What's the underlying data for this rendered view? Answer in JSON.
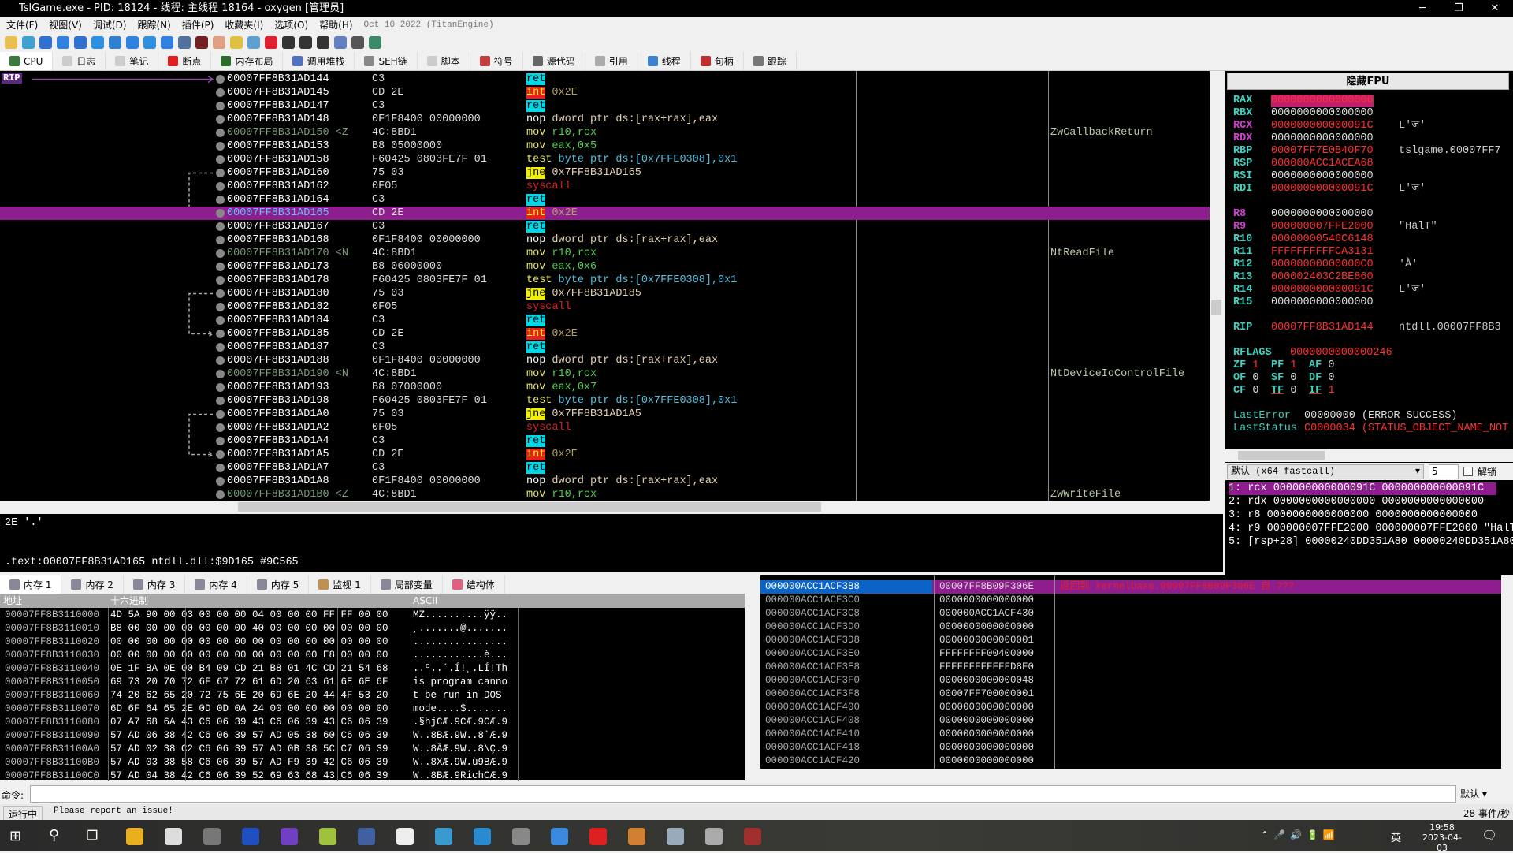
{
  "window": {
    "title": "TslGame.exe - PID: 18124 - 线程: 主线程 18164 - oxygen [管理员]",
    "minimize": "─",
    "maximize": "❐",
    "close": "✕"
  },
  "menu": [
    "文件(F)",
    "视图(V)",
    "调试(D)",
    "跟踪(N)",
    "插件(P)",
    "收藏夹(I)",
    "选项(O)",
    "帮助(H)"
  ],
  "version": "Oct 10 2022 (TitanEngine)",
  "toolbar_icons": [
    "open-icon",
    "restart-icon",
    "stop-icon",
    "run-icon",
    "pause-icon",
    "step-into-icon",
    "step-over-icon",
    "trace-into-icon",
    "trace-over-icon",
    "execute-till-return-icon",
    "run-to-user-code-icon",
    "scylla-icon",
    "patch-icon",
    "comment-icon",
    "label-icon",
    "bookmark-icon",
    "function-icon",
    "hash-icon",
    "font-icon",
    "calculator-icon",
    "notes-icon",
    "globe-icon"
  ],
  "tabs": [
    {
      "label": "CPU",
      "icon": "cpu-icon",
      "color": "#3a7a3a"
    },
    {
      "label": "日志",
      "icon": "log-icon",
      "color": "#ccc"
    },
    {
      "label": "笔记",
      "icon": "notes-icon",
      "color": "#ccc"
    },
    {
      "label": "断点",
      "icon": "breakpoint-icon",
      "color": "#e02020"
    },
    {
      "label": "内存布局",
      "icon": "memory-map-icon",
      "color": "#2a6a2a"
    },
    {
      "label": "调用堆栈",
      "icon": "call-stack-icon",
      "color": "#5070c0"
    },
    {
      "label": "SEH链",
      "icon": "seh-icon",
      "color": "#888"
    },
    {
      "label": "脚本",
      "icon": "script-icon",
      "color": "#ccc"
    },
    {
      "label": "符号",
      "icon": "symbols-icon",
      "color": "#c04040"
    },
    {
      "label": "源代码",
      "icon": "source-icon",
      "color": "#666"
    },
    {
      "label": "引用",
      "icon": "references-icon",
      "color": "#aaa"
    },
    {
      "label": "线程",
      "icon": "threads-icon",
      "color": "#4080d0"
    },
    {
      "label": "句柄",
      "icon": "handles-icon",
      "color": "#c03030"
    },
    {
      "label": "跟踪",
      "icon": "trace-icon",
      "color": "#777"
    }
  ],
  "rip_label": "RIP",
  "disasm": [
    {
      "addr": "00007FF8B31AD144",
      "lbl": "",
      "bytes": "C3",
      "m": "ret",
      "t": "ret",
      "ops": "",
      "cmt": ""
    },
    {
      "addr": "00007FF8B31AD145",
      "lbl": "",
      "bytes": "CD 2E",
      "m": "int",
      "t": "int",
      "ops": "0x2E",
      "cmt": ""
    },
    {
      "addr": "00007FF8B31AD147",
      "lbl": "",
      "bytes": "C3",
      "m": "ret",
      "t": "ret",
      "ops": "",
      "cmt": ""
    },
    {
      "addr": "00007FF8B31AD148",
      "lbl": "",
      "bytes": "0F1F8400 00000000",
      "m": "nop",
      "t": "nop",
      "ops": "dword ptr ds:[rax+rax],eax",
      "cmt": ""
    },
    {
      "addr": "00007FF8B31AD150",
      "lbl": " <Z",
      "bytes": "4C:8BD1",
      "m": "mov",
      "t": "mov",
      "ops": "r10,rcx",
      "cmt": "ZwCallbackReturn"
    },
    {
      "addr": "00007FF8B31AD153",
      "lbl": "",
      "bytes": "B8 05000000",
      "m": "mov",
      "t": "mov",
      "ops": "eax,0x5",
      "cmt": ""
    },
    {
      "addr": "00007FF8B31AD158",
      "lbl": "",
      "bytes": "F60425 0803FE7F 01",
      "m": "test",
      "t": "test",
      "ops": "byte ptr ds:[0x7FFE0308],0x1",
      "cmt": ""
    },
    {
      "addr": "00007FF8B31AD160",
      "lbl": "",
      "bytes": "75 03",
      "m": "jne",
      "t": "jne",
      "ops": "0x7FF8B31AD165",
      "cmt": ""
    },
    {
      "addr": "00007FF8B31AD162",
      "lbl": "",
      "bytes": "0F05",
      "m": "syscall",
      "t": "sys",
      "ops": "",
      "cmt": ""
    },
    {
      "addr": "00007FF8B31AD164",
      "lbl": "",
      "bytes": "C3",
      "m": "ret",
      "t": "ret",
      "ops": "",
      "cmt": ""
    },
    {
      "addr": "00007FF8B31AD165",
      "lbl": "",
      "bytes": "CD 2E",
      "m": "int",
      "t": "int",
      "ops": "0x2E",
      "cmt": "",
      "selected": true
    },
    {
      "addr": "00007FF8B31AD167",
      "lbl": "",
      "bytes": "C3",
      "m": "ret",
      "t": "ret",
      "ops": "",
      "cmt": ""
    },
    {
      "addr": "00007FF8B31AD168",
      "lbl": "",
      "bytes": "0F1F8400 00000000",
      "m": "nop",
      "t": "nop",
      "ops": "dword ptr ds:[rax+rax],eax",
      "cmt": ""
    },
    {
      "addr": "00007FF8B31AD170",
      "lbl": " <N",
      "bytes": "4C:8BD1",
      "m": "mov",
      "t": "mov",
      "ops": "r10,rcx",
      "cmt": "NtReadFile"
    },
    {
      "addr": "00007FF8B31AD173",
      "lbl": "",
      "bytes": "B8 06000000",
      "m": "mov",
      "t": "mov",
      "ops": "eax,0x6",
      "cmt": ""
    },
    {
      "addr": "00007FF8B31AD178",
      "lbl": "",
      "bytes": "F60425 0803FE7F 01",
      "m": "test",
      "t": "test",
      "ops": "byte ptr ds:[0x7FFE0308],0x1",
      "cmt": ""
    },
    {
      "addr": "00007FF8B31AD180",
      "lbl": "",
      "bytes": "75 03",
      "m": "jne",
      "t": "jne",
      "ops": "0x7FF8B31AD185",
      "cmt": ""
    },
    {
      "addr": "00007FF8B31AD182",
      "lbl": "",
      "bytes": "0F05",
      "m": "syscall",
      "t": "sys",
      "ops": "",
      "cmt": ""
    },
    {
      "addr": "00007FF8B31AD184",
      "lbl": "",
      "bytes": "C3",
      "m": "ret",
      "t": "ret",
      "ops": "",
      "cmt": ""
    },
    {
      "addr": "00007FF8B31AD185",
      "lbl": "",
      "bytes": "CD 2E",
      "m": "int",
      "t": "int",
      "ops": "0x2E",
      "cmt": ""
    },
    {
      "addr": "00007FF8B31AD187",
      "lbl": "",
      "bytes": "C3",
      "m": "ret",
      "t": "ret",
      "ops": "",
      "cmt": ""
    },
    {
      "addr": "00007FF8B31AD188",
      "lbl": "",
      "bytes": "0F1F8400 00000000",
      "m": "nop",
      "t": "nop",
      "ops": "dword ptr ds:[rax+rax],eax",
      "cmt": ""
    },
    {
      "addr": "00007FF8B31AD190",
      "lbl": " <N",
      "bytes": "4C:8BD1",
      "m": "mov",
      "t": "mov",
      "ops": "r10,rcx",
      "cmt": "NtDeviceIoControlFile"
    },
    {
      "addr": "00007FF8B31AD193",
      "lbl": "",
      "bytes": "B8 07000000",
      "m": "mov",
      "t": "mov",
      "ops": "eax,0x7",
      "cmt": ""
    },
    {
      "addr": "00007FF8B31AD198",
      "lbl": "",
      "bytes": "F60425 0803FE7F 01",
      "m": "test",
      "t": "test",
      "ops": "byte ptr ds:[0x7FFE0308],0x1",
      "cmt": ""
    },
    {
      "addr": "00007FF8B31AD1A0",
      "lbl": "",
      "bytes": "75 03",
      "m": "jne",
      "t": "jne",
      "ops": "0x7FF8B31AD1A5",
      "cmt": ""
    },
    {
      "addr": "00007FF8B31AD1A2",
      "lbl": "",
      "bytes": "0F05",
      "m": "syscall",
      "t": "sys",
      "ops": "",
      "cmt": ""
    },
    {
      "addr": "00007FF8B31AD1A4",
      "lbl": "",
      "bytes": "C3",
      "m": "ret",
      "t": "ret",
      "ops": "",
      "cmt": ""
    },
    {
      "addr": "00007FF8B31AD1A5",
      "lbl": "",
      "bytes": "CD 2E",
      "m": "int",
      "t": "int",
      "ops": "0x2E",
      "cmt": ""
    },
    {
      "addr": "00007FF8B31AD1A7",
      "lbl": "",
      "bytes": "C3",
      "m": "ret",
      "t": "ret",
      "ops": "",
      "cmt": ""
    },
    {
      "addr": "00007FF8B31AD1A8",
      "lbl": "",
      "bytes": "0F1F8400 00000000",
      "m": "nop",
      "t": "nop",
      "ops": "dword ptr ds:[rax+rax],eax",
      "cmt": ""
    },
    {
      "addr": "00007FF8B31AD1B0",
      "lbl": " <Z",
      "bytes": "4C:8BD1",
      "m": "mov",
      "t": "mov",
      "ops": "r10,rcx",
      "cmt": "ZwWriteFile"
    }
  ],
  "info": {
    "line1": "2E '.'",
    "line2": ".text:00007FF8B31AD165 ntdll.dll:$9D165 #9C565"
  },
  "fpu_button": "隐藏FPU",
  "registers": [
    {
      "n": "RAX",
      "v": "0000000000000006",
      "c": "",
      "chg": true,
      "hl": true
    },
    {
      "n": "RBX",
      "v": "0000000000000000",
      "c": ""
    },
    {
      "n": "RCX",
      "v": "000000000000091C",
      "c": "L'ज'",
      "chg": true,
      "mag": true
    },
    {
      "n": "RDX",
      "v": "0000000000000000",
      "c": "",
      "mag": true
    },
    {
      "n": "RBP",
      "v": "00007FF7E0B40F70",
      "c": "tslgame.00007FF7",
      "chg": true
    },
    {
      "n": "RSP",
      "v": "000000ACC1ACEA68",
      "c": "",
      "chg": true
    },
    {
      "n": "RSI",
      "v": "0000000000000000",
      "c": ""
    },
    {
      "n": "RDI",
      "v": "000000000000091C",
      "c": "L'ज'",
      "chg": true
    },
    {
      "gap": true
    },
    {
      "n": "R8",
      "v": "0000000000000000",
      "c": "",
      "mag": true
    },
    {
      "n": "R9",
      "v": "000000007FFE2000",
      "c": "\"HalT\"",
      "chg": true,
      "mag": true
    },
    {
      "n": "R10",
      "v": "00000000546C6148",
      "c": "",
      "chg": true
    },
    {
      "n": "R11",
      "v": "FFFFFFFFFFCA3131",
      "c": "",
      "chg": true
    },
    {
      "n": "R12",
      "v": "00000000000000C0",
      "c": "'À'",
      "chg": true
    },
    {
      "n": "R13",
      "v": "000002403C2BE860",
      "c": "",
      "chg": true
    },
    {
      "n": "R14",
      "v": "000000000000091C",
      "c": "L'ज'",
      "chg": true
    },
    {
      "n": "R15",
      "v": "0000000000000000",
      "c": ""
    },
    {
      "gap": true
    },
    {
      "n": "RIP",
      "v": "00007FF8B31AD144",
      "c": "ntdll.00007FF8B3",
      "chg": true
    }
  ],
  "rflags": {
    "label": "RFLAGS",
    "value": "0000000000000246",
    "flags": [
      [
        "ZF",
        "1"
      ],
      [
        "PF",
        "1"
      ],
      [
        "AF",
        "0"
      ],
      [
        "OF",
        "0"
      ],
      [
        "SF",
        "0"
      ],
      [
        "DF",
        "0"
      ],
      [
        "CF",
        "0"
      ],
      [
        "TF",
        "0"
      ],
      [
        "IF",
        "1"
      ]
    ]
  },
  "last_error": {
    "label": "LastError",
    "value": "00000000 (ERROR_SUCCESS)"
  },
  "last_status": {
    "label": "LastStatus",
    "value": "C0000034 (STATUS_OBJECT_NAME_NOT_FOUND)"
  },
  "callconv": {
    "selected": "默认 (x64 fastcall)",
    "count": "5",
    "unlock_label": "解锁",
    "unlocked": false
  },
  "args": [
    "1: rcx 000000000000091C 000000000000091C",
    "2: rdx 0000000000000000 0000000000000000",
    "3: r8 0000000000000000 0000000000000000",
    "4: r9 000000007FFE2000 000000007FFE2000 \"HalT\"",
    "5: [rsp+28] 00000240DD351A80 00000240DD351A80"
  ],
  "memtabs": [
    {
      "label": "内存 1",
      "icon": "memory-icon"
    },
    {
      "label": "内存 2",
      "icon": "memory-icon"
    },
    {
      "label": "内存 3",
      "icon": "memory-icon"
    },
    {
      "label": "内存 4",
      "icon": "memory-icon"
    },
    {
      "label": "内存 5",
      "icon": "memory-icon"
    },
    {
      "label": "监视 1",
      "icon": "watch-icon"
    },
    {
      "label": "局部变量",
      "icon": "locals-icon"
    },
    {
      "label": "结构体",
      "icon": "struct-icon"
    }
  ],
  "dump": {
    "headers": [
      "地址",
      "十六进制",
      "ASCII"
    ],
    "rows": [
      [
        "00007FF8B3110000",
        "4D 5A 90 00 03 00 00 00 04 00 00 00 FF FF 00 00",
        "MZ..........ÿÿ.."
      ],
      [
        "00007FF8B3110010",
        "B8 00 00 00 00 00 00 00 40 00 00 00 00 00 00 00",
        "¸.......@......."
      ],
      [
        "00007FF8B3110020",
        "00 00 00 00 00 00 00 00 00 00 00 00 00 00 00 00",
        "................"
      ],
      [
        "00007FF8B3110030",
        "00 00 00 00 00 00 00 00 00 00 00 00 E8 00 00 00",
        "............è..."
      ],
      [
        "00007FF8B3110040",
        "0E 1F BA 0E 00 B4 09 CD 21 B8 01 4C CD 21 54 68",
        "..º..´.Í!¸.LÍ!Th"
      ],
      [
        "00007FF8B3110050",
        "69 73 20 70 72 6F 67 72 61 6D 20 63 61 6E 6E 6F",
        "is program canno"
      ],
      [
        "00007FF8B3110060",
        "74 20 62 65 20 72 75 6E 20 69 6E 20 44 4F 53 20",
        "t be run in DOS "
      ],
      [
        "00007FF8B3110070",
        "6D 6F 64 65 2E 0D 0D 0A 24 00 00 00 00 00 00 00",
        "mode....$......."
      ],
      [
        "00007FF8B3110080",
        "07 A7 68 6A 43 C6 06 39 43 C6 06 39 43 C6 06 39",
        ".§hjCÆ.9CÆ.9CÆ.9"
      ],
      [
        "00007FF8B3110090",
        "57 AD 06 38 42 C6 06 39 57 AD 05 38 60 C6 06 39",
        "W..8BÆ.9W..8`Æ.9"
      ],
      [
        "00007FF8B31100A0",
        "57 AD 02 38 C2 C6 06 39 57 AD 0B 38 5C C7 06 39",
        "W..8ÂÆ.9W..8\\Ç.9"
      ],
      [
        "00007FF8B31100B0",
        "57 AD 03 38 58 C6 06 39 57 AD F9 39 42 C6 06 39",
        "W..8XÆ.9W.ù9BÆ.9"
      ],
      [
        "00007FF8B31100C0",
        "57 AD 04 38 42 C6 06 39 52 69 63 68 43 C6 06 39",
        "W..8BÆ.9RichCÆ.9"
      ]
    ]
  },
  "stack": [
    [
      "000000ACC1ACF3B8",
      "00007FF8B09F306E",
      "返回到 kernelbase.00007FF8B09F306E 自 ???"
    ],
    [
      "000000ACC1ACF3C0",
      "0000000000000000",
      ""
    ],
    [
      "000000ACC1ACF3C8",
      "000000ACC1ACF430",
      ""
    ],
    [
      "000000ACC1ACF3D0",
      "0000000000000000",
      ""
    ],
    [
      "000000ACC1ACF3D8",
      "0000000000000001",
      ""
    ],
    [
      "000000ACC1ACF3E0",
      "FFFFFFFF00400000",
      ""
    ],
    [
      "000000ACC1ACF3E8",
      "FFFFFFFFFFFFD8F0",
      ""
    ],
    [
      "000000ACC1ACF3F0",
      "0000000000000048",
      ""
    ],
    [
      "000000ACC1ACF3F8",
      "00007FF700000001",
      ""
    ],
    [
      "000000ACC1ACF400",
      "0000000000000000",
      ""
    ],
    [
      "000000ACC1ACF408",
      "0000000000000000",
      ""
    ],
    [
      "000000ACC1ACF410",
      "0000000000000000",
      ""
    ],
    [
      "000000ACC1ACF418",
      "0000000000000000",
      ""
    ],
    [
      "000000ACC1ACF420",
      "0000000000000000",
      ""
    ]
  ],
  "command": {
    "label": "命令:",
    "value": "",
    "mode": "默认"
  },
  "status": {
    "state": "运行中",
    "message": "Please report an issue!",
    "events": "28 事件/秒"
  },
  "taskbar": {
    "apps": [
      {
        "name": "chrome-icon",
        "color": "#e8b020"
      },
      {
        "name": "qq-icon",
        "color": "#ddd"
      },
      {
        "name": "app-icon",
        "color": "#777"
      },
      {
        "name": "nvidia-icon",
        "color": "#2050c0"
      },
      {
        "name": "visual-studio-icon",
        "color": "#7040c0"
      },
      {
        "name": "notepad-icon",
        "color": "#a0c040"
      },
      {
        "name": "calculator-icon",
        "color": "#4060a0"
      },
      {
        "name": "typora-icon",
        "color": "#eee"
      },
      {
        "name": "app-icon",
        "color": "#3a9ad0"
      },
      {
        "name": "bing-icon",
        "color": "#2a8ad0"
      },
      {
        "name": "app-icon",
        "color": "#888"
      },
      {
        "name": "feishu-icon",
        "color": "#3a8ae0"
      },
      {
        "name": "record-icon",
        "color": "#e02020"
      },
      {
        "name": "paint-icon",
        "color": "#d08030"
      },
      {
        "name": "window-icon",
        "color": "#9ab"
      },
      {
        "name": "explorer-icon",
        "color": "#aaa"
      },
      {
        "name": "x64dbg-icon",
        "color": "#a03030"
      }
    ],
    "time": "19:58",
    "date": "2023-04-03",
    "ime": "英"
  }
}
